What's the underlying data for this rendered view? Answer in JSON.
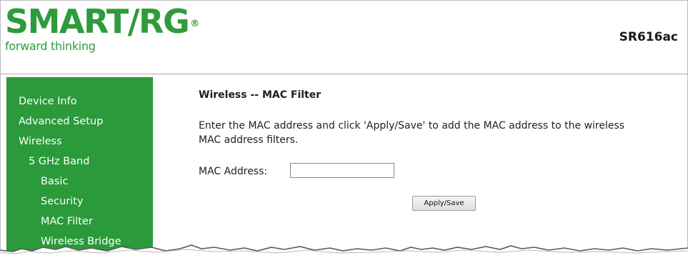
{
  "header": {
    "logo_text": "SMART/RG",
    "logo_registered": "®",
    "tagline": "forward thinking",
    "model": "SR616ac"
  },
  "sidebar": {
    "items": [
      {
        "label": "Device Info"
      },
      {
        "label": "Advanced Setup"
      },
      {
        "label": "Wireless"
      },
      {
        "label": "5 GHz Band"
      },
      {
        "label": "Basic"
      },
      {
        "label": "Security"
      },
      {
        "label": "MAC Filter"
      },
      {
        "label": "Wireless Bridge"
      }
    ]
  },
  "main": {
    "title": "Wireless -- MAC Filter",
    "description_line1": "Enter the MAC address and click 'Apply/Save' to add the MAC address to the wireless",
    "description_line2": "MAC address filters.",
    "mac_label": "MAC Address:",
    "mac_value": "",
    "apply_label": "Apply/Save"
  },
  "colors": {
    "brand_green": "#2e9b3c",
    "sidebar_green": "#2a9a3a"
  }
}
